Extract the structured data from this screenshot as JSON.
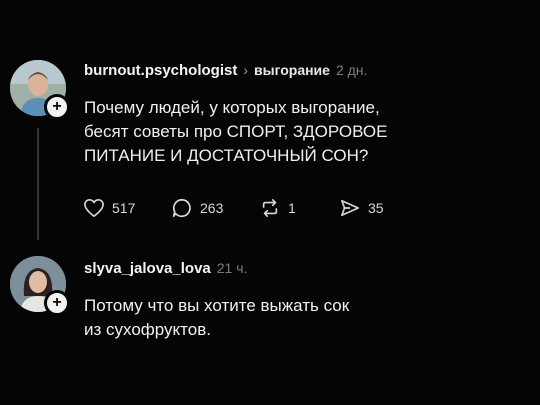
{
  "posts": [
    {
      "username": "burnout.psychologist",
      "topic": "выгорание",
      "time": "2 дн.",
      "text": "Почему людей, у которых выгорание,\nбесят советы про СПОРТ, ЗДОРОВОЕ\nПИТАНИЕ И ДОСТАТОЧНЫЙ СОН?",
      "likes": "517",
      "comments": "263",
      "reposts": "1",
      "shares": "35"
    },
    {
      "username": "slyva_jalova_lova",
      "time": "21 ч.",
      "text": "Потому что вы хотите выжать сок\nиз сухофруктов."
    }
  ],
  "icons": {
    "follow": "+",
    "chevron": "›",
    "like": "heart-icon",
    "comment": "comment-icon",
    "repost": "repost-icon",
    "share": "share-icon"
  }
}
